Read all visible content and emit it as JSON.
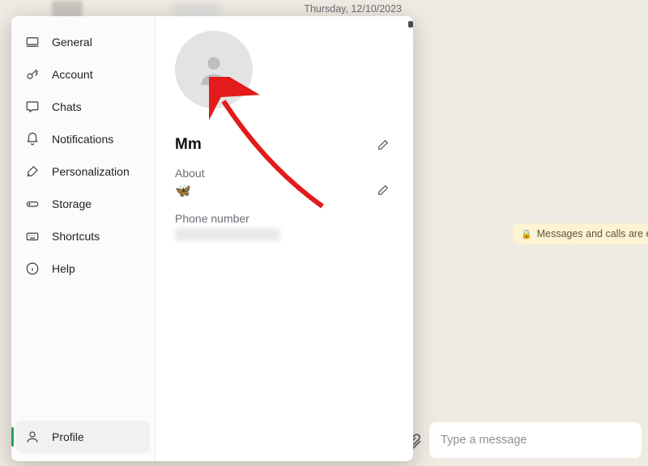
{
  "header": {
    "date": "Thursday, 12/10/2023"
  },
  "sidebar": {
    "items": [
      {
        "label": "General"
      },
      {
        "label": "Account"
      },
      {
        "label": "Chats"
      },
      {
        "label": "Notifications"
      },
      {
        "label": "Personalization"
      },
      {
        "label": "Storage"
      },
      {
        "label": "Shortcuts"
      },
      {
        "label": "Help"
      }
    ],
    "profile_label": "Profile"
  },
  "profile": {
    "name": "Mm",
    "about_label": "About",
    "about_value": "🦋",
    "phone_label": "Phone number"
  },
  "chat": {
    "encryption_notice": "Messages and calls are end-to-end enc",
    "composer_placeholder": "Type a message"
  }
}
